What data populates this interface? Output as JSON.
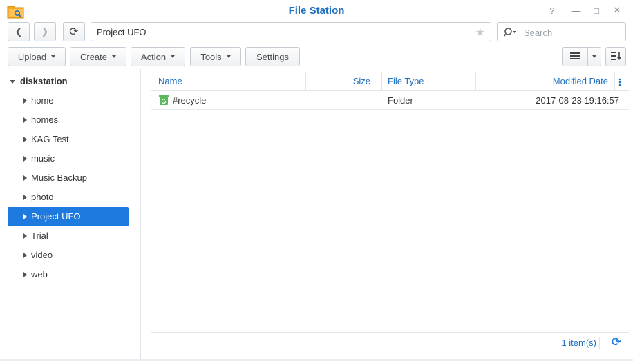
{
  "window": {
    "title": "File Station",
    "help_glyph": "?",
    "minimize_glyph": "—",
    "maximize_glyph": "□",
    "close_glyph": "✕"
  },
  "toolbar": {
    "back_glyph": "❮",
    "forward_glyph": "❯",
    "refresh_glyph": "⟳",
    "path": "Project UFO",
    "bookmark_glyph": "★",
    "search_placeholder": "Search",
    "upload_label": "Upload",
    "create_label": "Create",
    "action_label": "Action",
    "tools_label": "Tools",
    "settings_label": "Settings"
  },
  "sidebar": {
    "root": "diskstation",
    "items": [
      {
        "label": "home"
      },
      {
        "label": "homes"
      },
      {
        "label": "KAG Test"
      },
      {
        "label": "music"
      },
      {
        "label": "Music Backup"
      },
      {
        "label": "photo"
      },
      {
        "label": "Project UFO",
        "selected": true
      },
      {
        "label": "Trial"
      },
      {
        "label": "video"
      },
      {
        "label": "web"
      }
    ]
  },
  "table": {
    "columns": {
      "name": "Name",
      "size": "Size",
      "type": "File Type",
      "modified": "Modified Date"
    },
    "rows": [
      {
        "name": "#recycle",
        "size": "",
        "type": "Folder",
        "modified": "2017-08-23 19:16:57",
        "icon": "recycle-folder-icon"
      }
    ]
  },
  "status": {
    "count": "1 item(s)",
    "refresh_glyph": "⟳"
  },
  "colors": {
    "accent": "#1f7ae0",
    "link": "#1f6fbf",
    "folder_orange": "#f5a623",
    "recycle_green": "#5cb85c"
  }
}
